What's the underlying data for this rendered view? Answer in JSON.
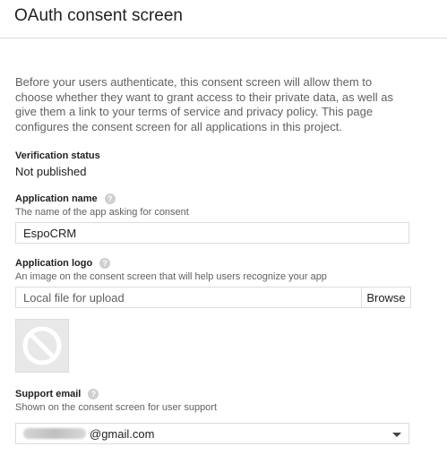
{
  "header": {
    "title": "OAuth consent screen"
  },
  "description": "Before your users authenticate, this consent screen will allow them to choose whether they want to grant access to their private data, as well as give them a link to your terms of service and privacy policy. This page configures the consent screen for all applications in this project.",
  "verification": {
    "label": "Verification status",
    "value": "Not published"
  },
  "app_name": {
    "label": "Application name",
    "help_icon": "?",
    "hint": "The name of the app asking for consent",
    "value": "EspoCRM"
  },
  "app_logo": {
    "label": "Application logo",
    "help_icon": "?",
    "hint": "An image on the consent screen that will help users recognize your app",
    "placeholder": "Local file for upload",
    "browse_label": "Browse",
    "placeholder_icon": "no-image-icon"
  },
  "support_email": {
    "label": "Support email",
    "help_icon": "?",
    "hint": "Shown on the consent screen for user support",
    "value_suffix": "@gmail.com",
    "dropdown_icon": "chevron-down-icon"
  }
}
